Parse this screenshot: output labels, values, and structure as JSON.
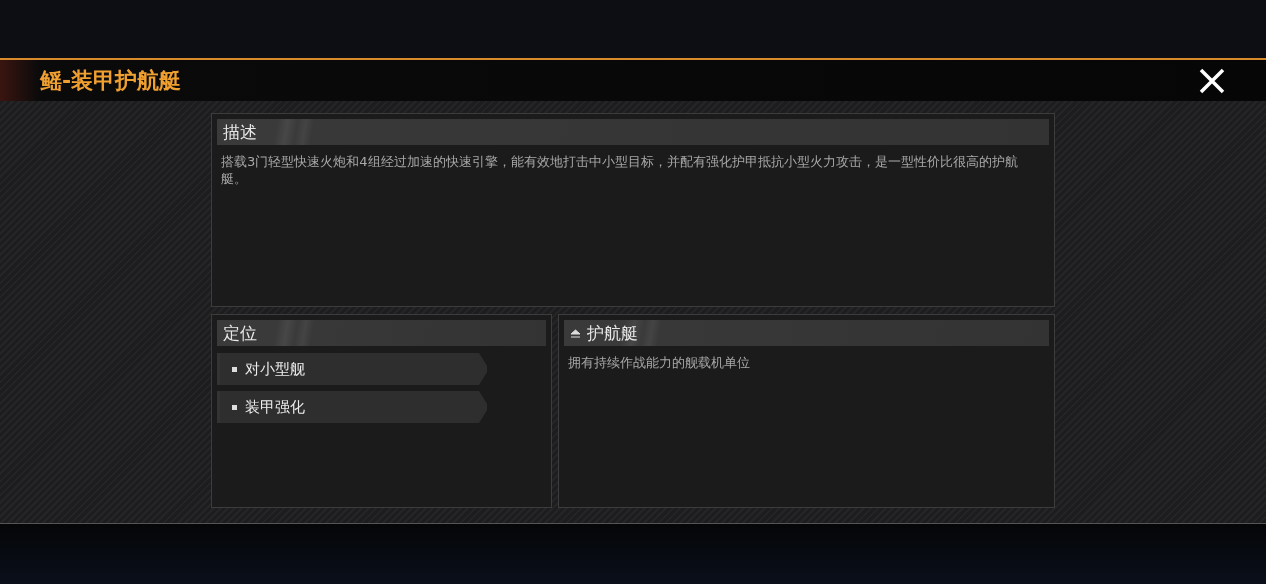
{
  "dialog": {
    "title": "鳐-装甲护航艇"
  },
  "description": {
    "heading": "描述",
    "text": "搭载3门轻型快速火炮和4组经过加速的快速引擎，能有效地打击中小型目标，并配有强化护甲抵抗小型火力攻击，是一型性价比很高的护航艇。"
  },
  "positioning": {
    "heading": "定位",
    "tags": [
      "对小型舰",
      "装甲强化"
    ]
  },
  "ship_class": {
    "heading": "护航艇",
    "text": "拥有持续作战能力的舰载机单位"
  }
}
